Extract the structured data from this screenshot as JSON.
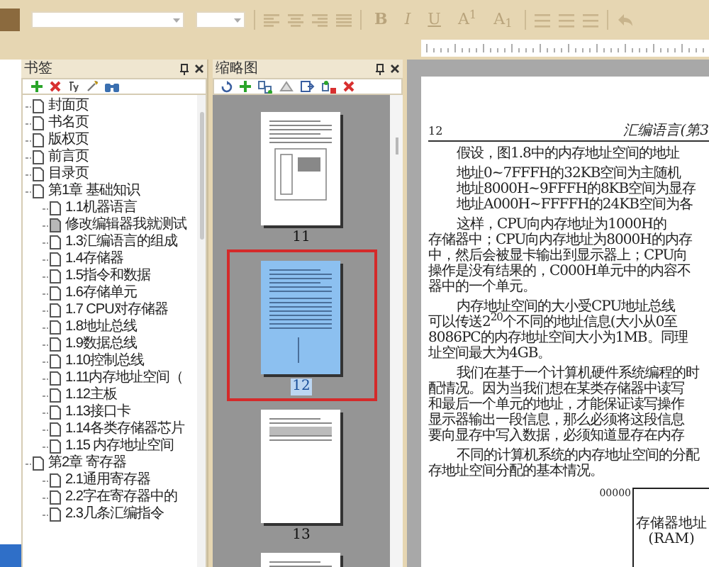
{
  "toolbar": {
    "format_buttons": [
      {
        "label": "B",
        "kind": "bold"
      },
      {
        "label": "I",
        "kind": "italic"
      },
      {
        "label": "U",
        "kind": "underline"
      },
      {
        "label": "A$^{1}$",
        "kind": "plain"
      },
      {
        "label": "A$_{1}$",
        "kind": "plain"
      }
    ]
  },
  "bookmarks_panel": {
    "title": "书签",
    "items": [
      {
        "label": "封面页",
        "selected": false
      },
      {
        "label": "书名页",
        "selected": false
      },
      {
        "label": "版权页",
        "selected": false
      },
      {
        "label": "前言页",
        "selected": false
      },
      {
        "label": "目录页",
        "selected": false
      },
      {
        "label": "第1章  基础知识",
        "selected": false,
        "children": [
          {
            "label": "1.1机器语言",
            "selected": false
          },
          {
            "label": "修改编辑器我就测试",
            "selected": true
          },
          {
            "label": "1.3汇编语言的组成",
            "selected": false
          },
          {
            "label": "1.4存储器",
            "selected": false
          },
          {
            "label": "1.5指令和数据",
            "selected": false
          },
          {
            "label": "1.6存储单元",
            "selected": false
          },
          {
            "label": "1.7  CPU对存储器",
            "selected": false
          },
          {
            "label": "1.8地址总线",
            "selected": false
          },
          {
            "label": "1.9数据总线",
            "selected": false
          },
          {
            "label": "1.10控制总线",
            "selected": false
          },
          {
            "label": "1.11内存地址空间（",
            "selected": false
          },
          {
            "label": "1.12主板",
            "selected": false
          },
          {
            "label": "1.13接口卡",
            "selected": false
          },
          {
            "label": "1.14各类存储器芯片",
            "selected": false
          },
          {
            "label": "1.15  内存地址空间",
            "selected": false
          }
        ]
      },
      {
        "label": "第2章  寄存器",
        "selected": false,
        "children": [
          {
            "label": "2.1通用寄存器",
            "selected": false
          },
          {
            "label": "2.2字在寄存器中的",
            "selected": false
          },
          {
            "label": "2.3几条汇编指令",
            "selected": false
          }
        ]
      }
    ]
  },
  "thumbnails_panel": {
    "title": "缩略图",
    "pages": [
      {
        "label": "11",
        "selected": false
      },
      {
        "label": "12",
        "selected": true
      },
      {
        "label": "13",
        "selected": false
      },
      {
        "selected": false
      }
    ]
  },
  "document": {
    "page_number": "12",
    "running_header": "汇编语言(第3",
    "paragraphs": [
      {
        "kind": "body",
        "lines": [
          "假设，图1.8中的内存地址空间的地址"
        ]
      },
      {
        "kind": "block",
        "lines": [
          "地址0~7FFFH的32KB空间为主随机",
          "地址8000H~9FFFH的8KB空间为显存",
          "地址A000H~FFFFH的24KB空间为各"
        ]
      },
      {
        "kind": "body",
        "lines": [
          "这样，CPU向内存地址为1000H的",
          "存储器中；CPU向内存地址为8000H的内存",
          "中，然后会被显卡输出到显示器上；CPU向",
          "操作是没有结果的，C000H单元中的内容不",
          "器中的一个单元。"
        ]
      },
      {
        "kind": "body",
        "lines": [
          "内存地址空间的大小受CPU地址总线",
          "可以传送2$^{20}$个不同的地址信息(大小从0至",
          "8086PC的内存地址空间大小为1MB。同理",
          "址空间最大为4GB。"
        ]
      },
      {
        "kind": "body",
        "lines": [
          "我们在基于一个计算机硬件系统编程的时",
          "配情况。因为当我们想在某类存储器中读写",
          "和最后一个单元的地址，才能保证读写操作",
          "显示器输出一段信息，那么必须将这段信息",
          "要向显存中写入数据，必须知道显存在内存"
        ]
      },
      {
        "kind": "body",
        "lines": [
          "不同的计算机系统的内存地址空间的分配",
          "存地址空间分配的基本情况。"
        ]
      }
    ],
    "figure": {
      "address": "00000",
      "box_lines": [
        "存储器地址",
        "(RAM)"
      ]
    }
  }
}
